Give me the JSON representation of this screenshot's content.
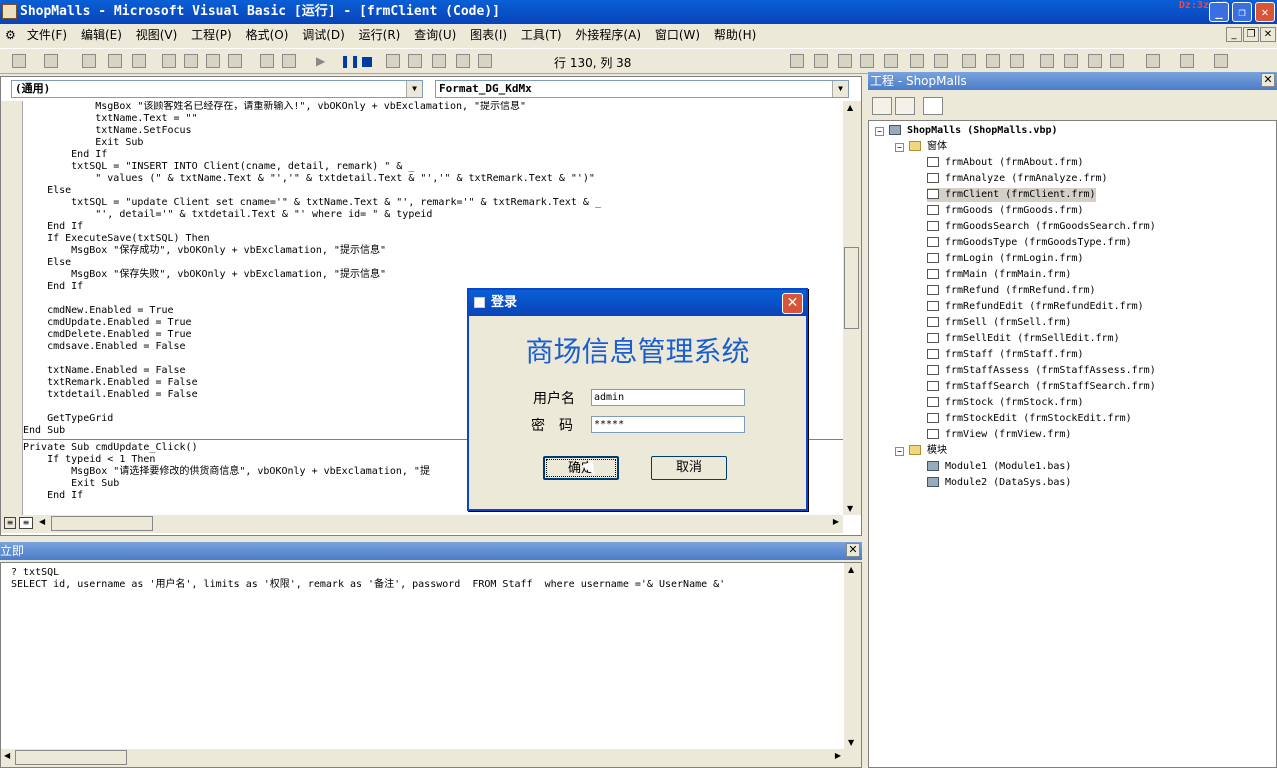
{
  "window": {
    "title": "ShopMalls - Microsoft Visual Basic [运行] - [frmClient (Code)]",
    "clock": "Dz:3z:05"
  },
  "menu": [
    "文件(F)",
    "编辑(E)",
    "视图(V)",
    "工程(P)",
    "格式(O)",
    "调试(D)",
    "运行(R)",
    "查询(U)",
    "图表(I)",
    "工具(T)",
    "外接程序(A)",
    "窗口(W)",
    "帮助(H)"
  ],
  "toolbar": {
    "position": "行 130, 列 38"
  },
  "code": {
    "object_dropdown": "(通用)",
    "proc_dropdown": "Format_DG_KdMx",
    "lines_top": [
      "            MsgBox \"该顾客姓名已经存在，请重新输入!\", vbOKOnly + vbExclamation, \"提示信息\"",
      "            txtName.Text = \"\"",
      "            txtName.SetFocus",
      "            Exit Sub",
      "        End If",
      "        txtSQL = \"INSERT INTO Client(cname, detail, remark) \" & _",
      "            \" values (\" & txtName.Text & \"','\" & txtdetail.Text & \"','\" & txtRemark.Text & \"')\"",
      "    Else",
      "        txtSQL = \"update Client set cname='\" & txtName.Text & \"', remark='\" & txtRemark.Text & _",
      "            \"', detail='\" & txtdetail.Text & \"' where id= \" & typeid",
      "    End If",
      "    If ExecuteSave(txtSQL) Then",
      "        MsgBox \"保存成功\", vbOKOnly + vbExclamation, \"提示信息\"",
      "    Else",
      "        MsgBox \"保存失败\", vbOKOnly + vbExclamation, \"提示信息\"",
      "    End If",
      "",
      "    cmdNew.Enabled = True",
      "    cmdUpdate.Enabled = True",
      "    cmdDelete.Enabled = True",
      "    cmdsave.Enabled = False",
      "",
      "    txtName.Enabled = False",
      "    txtRemark.Enabled = False",
      "    txtdetail.Enabled = False",
      "",
      "    GetTypeGrid",
      "End Sub"
    ],
    "lines_bottom": [
      "Private Sub cmdUpdate_Click()",
      "    If typeid < 1 Then",
      "        MsgBox \"请选择要修改的供货商信息\", vbOKOnly + vbExclamation, \"提",
      "        Exit Sub",
      "    End If"
    ]
  },
  "immediate": {
    "title": "立即",
    "lines": [
      "? txtSQL",
      "SELECT id, username as '用户名', limits as '权限', remark as '备注', password  FROM Staff  where username ='& UserName &'"
    ]
  },
  "project": {
    "title": "工程 - ShopMalls",
    "root": "ShopMalls (ShopMalls.vbp)",
    "forms_folder": "窗体",
    "forms": [
      "frmAbout (frmAbout.frm)",
      "frmAnalyze (frmAnalyze.frm)",
      "frmClient (frmClient.frm)",
      "frmGoods (frmGoods.frm)",
      "frmGoodsSearch (frmGoodsSearch.frm)",
      "frmGoodsType (frmGoodsType.frm)",
      "frmLogin (frmLogin.frm)",
      "frmMain (frmMain.frm)",
      "frmRefund (frmRefund.frm)",
      "frmRefundEdit (frmRefundEdit.frm)",
      "frmSell (frmSell.frm)",
      "frmSellEdit (frmSellEdit.frm)",
      "frmStaff (frmStaff.frm)",
      "frmStaffAssess (frmStaffAssess.frm)",
      "frmStaffSearch (frmStaffSearch.frm)",
      "frmStock (frmStock.frm)",
      "frmStockEdit (frmStockEdit.frm)",
      "frmView (frmView.frm)"
    ],
    "modules_folder": "模块",
    "modules": [
      "Module1 (Module1.bas)",
      "Module2 (DataSys.bas)"
    ]
  },
  "login": {
    "title": "登录",
    "heading": "商场信息管理系统",
    "username_label": "用户名",
    "password_label": "密　码",
    "username_value": "admin",
    "password_value": "*****",
    "ok": "确定",
    "cancel": "取消"
  }
}
